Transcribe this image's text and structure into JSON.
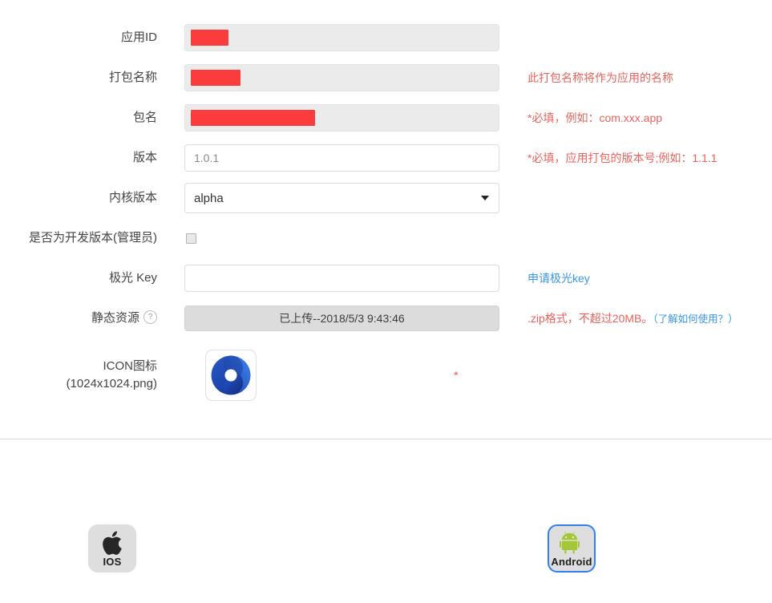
{
  "form": {
    "rows": [
      {
        "label": "应用ID",
        "field_type": "text-disabled-redacted",
        "value": "",
        "redact_width": 47,
        "hint": ""
      },
      {
        "label": "打包名称",
        "field_type": "text-disabled-redacted",
        "value": "",
        "redact_width": 62,
        "hint": "此打包名称将作为应用的名称"
      },
      {
        "label": "包名",
        "field_type": "text-disabled-redacted",
        "value": "",
        "redact_width": 155,
        "hint": "*必填，例如：com.xxx.app"
      },
      {
        "label": "版本",
        "field_type": "text",
        "value": "1.0.1",
        "hint": "*必填，应用打包的版本号;例如：1.1.1"
      },
      {
        "label": "内核版本",
        "field_type": "select",
        "value": "alpha",
        "options": [
          "alpha"
        ],
        "hint": ""
      },
      {
        "label": "是否为开发版本(管理员)",
        "field_type": "checkbox",
        "checked": false,
        "hint": ""
      },
      {
        "label": "极光 Key",
        "field_type": "text",
        "value": "",
        "placeholder": "",
        "hint_link": "申请极光key"
      }
    ],
    "static_resource": {
      "label": "静态资源",
      "help_icon": "question-circle-icon",
      "upload_button_label": "已上传--2018/5/3 9:43:46",
      "hint_red": ".zip格式，不超过20MB。",
      "hint_link": "（了解如何使用？）"
    },
    "app_icon": {
      "label_line1": "ICON图标",
      "label_line2": "(1024x1024.png)",
      "icon_name": "app-logo-ring-icon",
      "required_mark": "*"
    }
  },
  "platforms": [
    {
      "id": "ios",
      "label": "IOS",
      "icon_name": "apple-icon",
      "selected": false
    },
    {
      "id": "android",
      "label": "Android",
      "icon_name": "android-icon",
      "selected": true
    }
  ],
  "colors": {
    "redaction": "#fa3c3c",
    "hint_red": "#e8635c",
    "link_blue": "#3b97e3",
    "selected_border": "#2f80ed",
    "android_green": "#a4c639",
    "icon_blue_light": "#2f6fe8",
    "icon_blue_dark": "#132a6b"
  }
}
